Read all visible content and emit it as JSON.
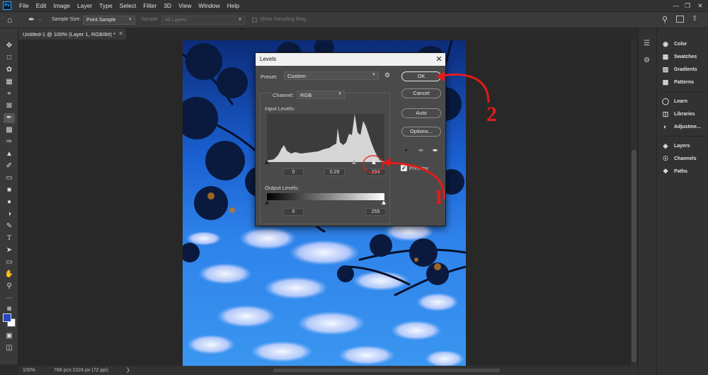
{
  "app": {
    "logo": "Ps",
    "menu": [
      "File",
      "Edit",
      "Image",
      "Layer",
      "Type",
      "Select",
      "Filter",
      "3D",
      "View",
      "Window",
      "Help"
    ]
  },
  "options_bar": {
    "sample_size_label": "Sample Size:",
    "sample_size_value": "Point Sample",
    "sample_label": "Sample:",
    "sample_value": "All Layers",
    "show_ring_label": "Show Sampling Ring"
  },
  "document": {
    "tab_title": "Untitled-1 @ 100% (Layer 1, RGB/8#) *",
    "zoom": "100%",
    "doc_info": "768 pcx:1024 px (72 ppi)"
  },
  "panels": {
    "group1": [
      "Color",
      "Swatches",
      "Gradients",
      "Patterns"
    ],
    "group2": [
      "Learn",
      "Libraries",
      "Adjustme..."
    ],
    "group3": [
      "Layers",
      "Channels",
      "Paths"
    ]
  },
  "levels_dialog": {
    "title": "Levels",
    "preset_label": "Preset:",
    "preset_value": "Custom",
    "channel_label": "Channel:",
    "channel_value": "RGB",
    "input_levels_label": "Input Levels:",
    "input_black": "0",
    "input_gamma": "0.29",
    "input_white": "234",
    "output_levels_label": "Output Levels:",
    "output_black": "0",
    "output_white": "255",
    "buttons": {
      "ok": "OK",
      "cancel": "Cancel",
      "auto": "Auto",
      "options": "Options..."
    },
    "preview_label": "Preview",
    "preview_checked": true
  },
  "annotations": {
    "step1": "1",
    "step2": "2",
    "color": "#e21b1b"
  },
  "colors": {
    "foreground": "#2646c8",
    "background": "#ffffff",
    "accent_sky": "#2e82ea"
  }
}
